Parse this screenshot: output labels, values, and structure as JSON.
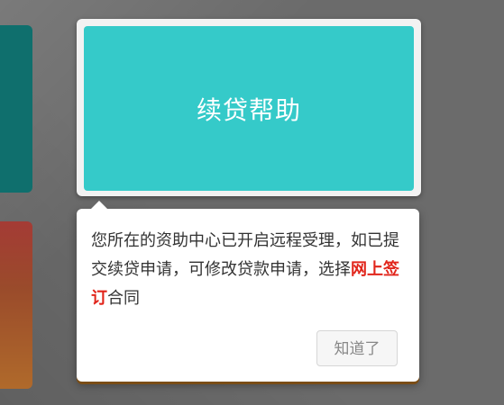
{
  "tile": {
    "title": "续贷帮助"
  },
  "popover": {
    "message_before": "您所在的资助中心已开启远程受理，如已提交续贷申请，可修改贷款申请，选择",
    "message_highlight": "网上签订",
    "message_after": "合同",
    "ok_label": "知道了"
  },
  "colors": {
    "tile_accent": "#35cac9",
    "highlight": "#e1251b"
  }
}
